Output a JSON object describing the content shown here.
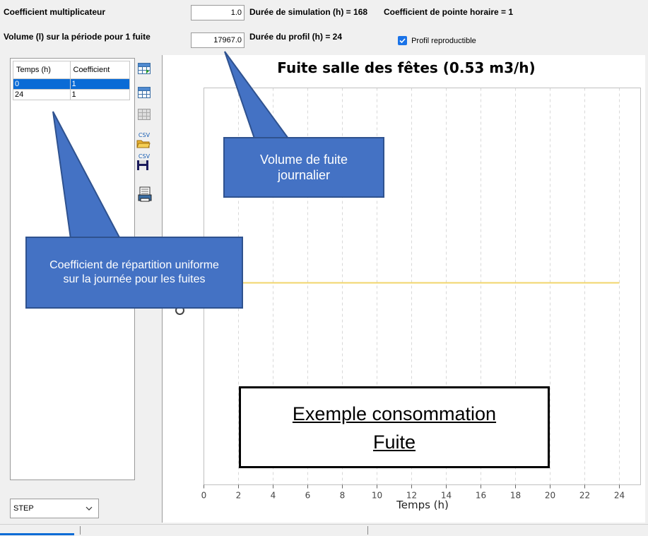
{
  "header": {
    "coef_label": "Coefficient multiplicateur",
    "coef_value": "1.0",
    "sim_duration": "Durée de simulation (h) = 168",
    "peak_coef": "Coefficient de pointe horaire = 1",
    "volume_label": "Volume (l) sur la période pour 1 fuite",
    "volume_value": "17967.0",
    "profile_duration": "Durée du profil (h) = 24",
    "reproducible_label": "Profil reproductible",
    "reproducible_checked": true
  },
  "table": {
    "columns": [
      "Temps (h)",
      "Coefficient"
    ],
    "rows": [
      {
        "t": "0",
        "c": "1",
        "selected": true
      },
      {
        "t": "24",
        "c": "1",
        "selected": false
      }
    ]
  },
  "toolbar": {
    "csv_open": "CSV",
    "csv_save": "CSV",
    "icons": [
      "insert-row-icon",
      "grid-icon",
      "delete-row-icon",
      "csv-open-icon",
      "csv-save-icon",
      "print-icon"
    ]
  },
  "interp_select": "STEP",
  "chart_data": {
    "type": "line",
    "title": "Fuite salle des fêtes (0.53 m3/h)",
    "xlabel": "Temps (h)",
    "ylabel": "",
    "xlim": [
      0,
      24
    ],
    "x_ticks": [
      "0",
      "2",
      "4",
      "6",
      "8",
      "10",
      "12",
      "14",
      "16",
      "18",
      "20",
      "22",
      "24"
    ],
    "series": [
      {
        "x": [
          0,
          24
        ],
        "y": [
          1,
          1
        ],
        "color": "#f2d56b"
      }
    ],
    "grid": true
  },
  "callouts": {
    "volume": "Volume de fuite journalier",
    "coefficient": "Coefficient de répartition uniforme sur la journée pour les fuites",
    "example_line1": "Exemple consommation",
    "example_line2": "Fuite"
  },
  "colors": {
    "selection": "#0a6bd6",
    "callout_fill": "#4472c4",
    "curve": "#f2d56b",
    "checkbox": "#1a73e8"
  }
}
